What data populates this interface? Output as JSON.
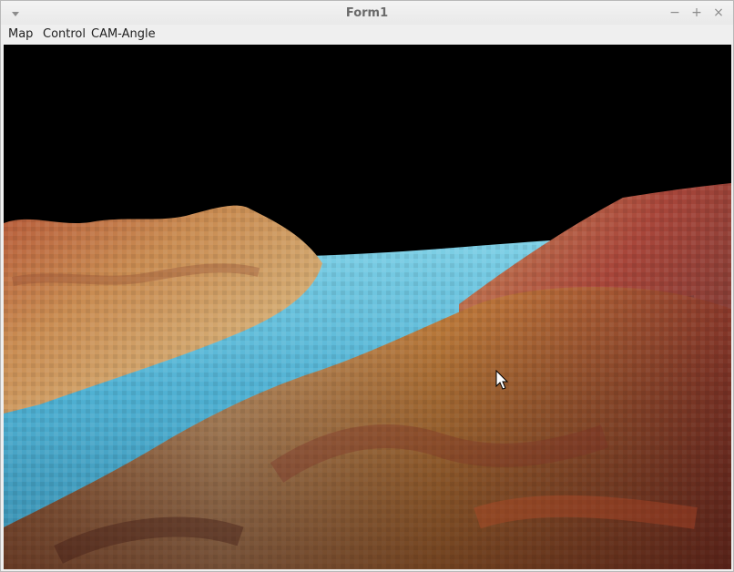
{
  "window": {
    "title": "Form1",
    "minimize_glyph": "−",
    "maximize_glyph": "+",
    "close_glyph": "×"
  },
  "menu": {
    "items": [
      {
        "label": "Map"
      },
      {
        "label": "Control"
      },
      {
        "label": "CAM-Angle"
      }
    ]
  },
  "icons": {
    "system_menu": "chevron-down-icon",
    "cursor": "mouse-pointer-icon"
  },
  "colors": {
    "sky": "#000000",
    "water": "#5ab8d6",
    "terrain_tan": "#c8975c",
    "terrain_red": "#a33a2c",
    "terrain_dark": "#5a2e22"
  }
}
